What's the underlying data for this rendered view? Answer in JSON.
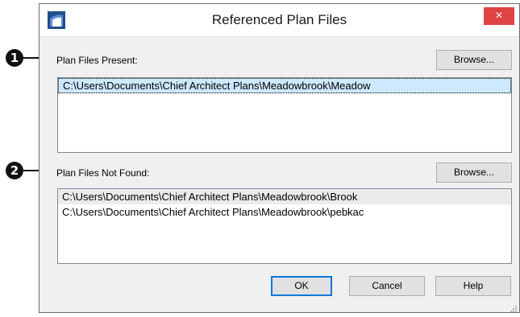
{
  "window": {
    "title": "Referenced Plan Files",
    "close_glyph": "×",
    "app_icon": "chief-architect-logo-icon"
  },
  "callouts": [
    "1",
    "2"
  ],
  "present": {
    "label": "Plan Files Present:",
    "browse_label": "Browse...",
    "items": [
      "C:\\Users\\Documents\\Chief Architect Plans\\Meadowbrook\\Meadow"
    ]
  },
  "not_found": {
    "label": "Plan Files Not Found:",
    "browse_label": "Browse...",
    "items": [
      "C:\\Users\\Documents\\Chief Architect Plans\\Meadowbrook\\Brook",
      "C:\\Users\\Documents\\Chief Architect Plans\\Meadowbrook\\pebkac"
    ]
  },
  "buttons": {
    "ok": "OK",
    "cancel": "Cancel",
    "help": "Help"
  },
  "colors": {
    "close_button": "#e04343",
    "selection": "#cde8ff",
    "default_button_border": "#0078d7"
  }
}
